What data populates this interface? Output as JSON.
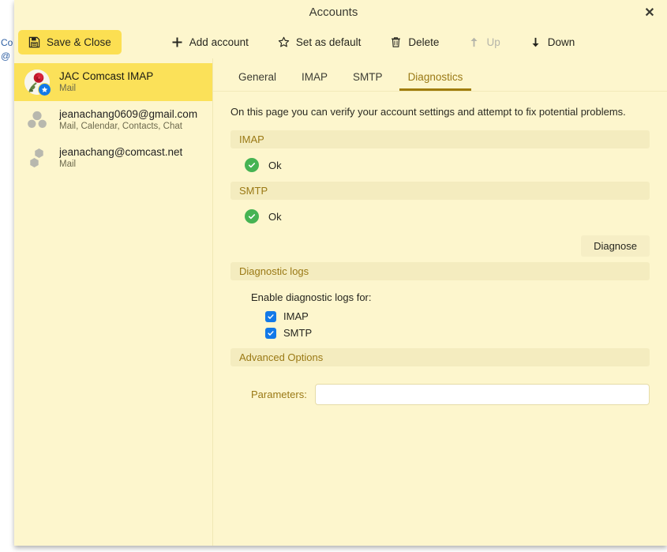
{
  "background_window": {
    "fragment_1": "Co",
    "fragment_2": "@"
  },
  "dialog": {
    "title": "Accounts",
    "close_label": "✕"
  },
  "toolbar": {
    "save_close_label": "Save & Close",
    "save_icon": "floppy-disk-save-icon",
    "items": [
      {
        "label": "Add account",
        "icon": "plus-icon",
        "disabled": false
      },
      {
        "label": "Set as default",
        "icon": "star-outline-icon",
        "disabled": false
      },
      {
        "label": "Delete",
        "icon": "trash-can-icon",
        "disabled": false
      },
      {
        "label": "Up",
        "icon": "arrow-up-icon",
        "disabled": true
      },
      {
        "label": "Down",
        "icon": "arrow-down-icon",
        "disabled": false
      }
    ]
  },
  "sidebar": {
    "accounts": [
      {
        "name": "JAC Comcast IMAP",
        "services": "Mail",
        "avatar": "rose-photo-avatar",
        "default_badge": "star-badge-icon",
        "selected": true
      },
      {
        "name": "jeanachang0609@gmail.com",
        "services": "Mail, Calendar, Contacts, Chat",
        "avatar": "generic-contacts-avatar",
        "default_badge": null,
        "selected": false
      },
      {
        "name": "jeanachang@comcast.net",
        "services": "Mail",
        "avatar": "generic-hexagon-avatar",
        "default_badge": null,
        "selected": false
      }
    ]
  },
  "tabs": [
    {
      "label": "General",
      "active": false
    },
    {
      "label": "IMAP",
      "active": false
    },
    {
      "label": "SMTP",
      "active": false
    },
    {
      "label": "Diagnostics",
      "active": true
    }
  ],
  "diagnostics": {
    "intro": "On this page you can verify your account settings and attempt to fix potential problems.",
    "imap_section": {
      "header": "IMAP",
      "status_icon": "green-check-circle-icon",
      "status_text": "Ok"
    },
    "smtp_section": {
      "header": "SMTP",
      "status_icon": "green-check-circle-icon",
      "status_text": "Ok"
    },
    "diagnose_button": "Diagnose",
    "logs_section": {
      "header": "Diagnostic logs",
      "label": "Enable diagnostic logs for:",
      "checkboxes": [
        {
          "label": "IMAP",
          "checked": true
        },
        {
          "label": "SMTP",
          "checked": true
        }
      ]
    },
    "advanced_section": {
      "header": "Advanced Options",
      "parameters_label": "Parameters:",
      "parameters_value": "",
      "parameters_placeholder": ""
    }
  },
  "colors": {
    "dialog_bg": "#fdf6cd",
    "selected_account": "#fbe159",
    "save_button": "#fcdf52",
    "section_header_bg": "#f4ecbf",
    "section_header_text": "#9a7915",
    "active_tab_underline": "#a07d0d",
    "checkbox_blue": "#1279e8",
    "status_green": "#46b353"
  }
}
